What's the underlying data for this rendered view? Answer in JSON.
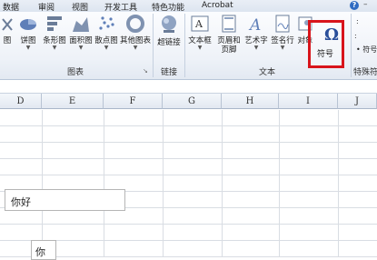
{
  "menubar": {
    "items": [
      "数据",
      "审阅",
      "视图",
      "开发工具",
      "特色功能",
      "Acrobat"
    ]
  },
  "ribbon": {
    "charts": {
      "buttons": [
        "饼图",
        "条形图",
        "面积图",
        "散点图",
        "其他图表"
      ],
      "partial_label": "图",
      "group_label": "图表"
    },
    "links": {
      "button": "超链接",
      "group_label": "链接"
    },
    "text": {
      "textbox": "文本框",
      "header_footer_1": "页眉和",
      "header_footer_2": "页脚",
      "wordart": "艺术字",
      "signature": "签名行",
      "object": "对象",
      "group_label": "文本"
    },
    "symbol": {
      "glyph": "Ω",
      "label": "符号"
    },
    "special": {
      "group_label": "特殊符",
      "partial_item": "• 符号"
    }
  },
  "columns": [
    "D",
    "E",
    "F",
    "G",
    "H",
    "I",
    "J"
  ],
  "cells": {
    "a": "你好",
    "b": "你"
  },
  "colors": {
    "highlight": "#d8141b",
    "accent": "#2a4f9a"
  }
}
